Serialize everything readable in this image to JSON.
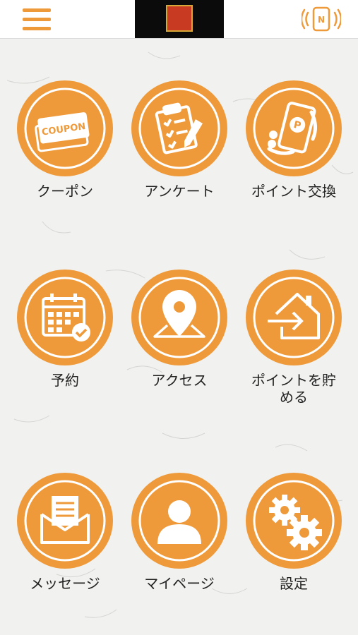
{
  "header": {
    "menu_icon": "hamburger-menu-icon",
    "logo_text": "",
    "nfc_icon": "nfc-phone-icon",
    "nfc_label": "N"
  },
  "colors": {
    "accent": "#ef9a3a",
    "label": "#222222",
    "background": "#f1f1ef"
  },
  "menu": {
    "items": [
      {
        "label": "クーポン",
        "icon": "coupon-icon",
        "icon_text": "COUPON"
      },
      {
        "label": "アンケート",
        "icon": "clipboard-survey-icon"
      },
      {
        "label": "ポイント交換",
        "icon": "phone-point-exchange-icon",
        "icon_text": "P"
      },
      {
        "label": "予約",
        "icon": "calendar-reservation-icon"
      },
      {
        "label": "アクセス",
        "icon": "map-pin-icon"
      },
      {
        "label": "ポイントを貯める",
        "label_line1": "ポイントを貯",
        "label_line2": "める",
        "icon": "house-enter-icon"
      },
      {
        "label": "メッセージ",
        "icon": "envelope-message-icon"
      },
      {
        "label": "マイページ",
        "icon": "user-profile-icon"
      },
      {
        "label": "設定",
        "icon": "gears-settings-icon"
      }
    ]
  }
}
